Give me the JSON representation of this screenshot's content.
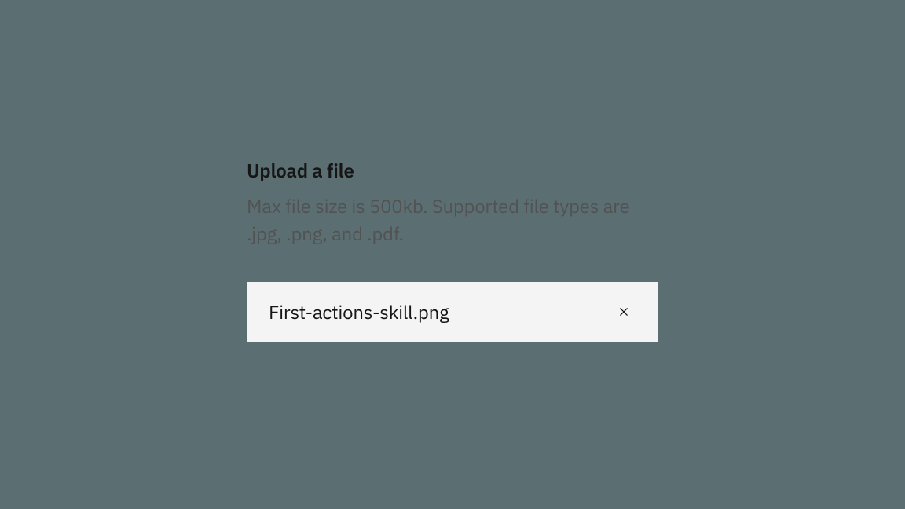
{
  "upload": {
    "title": "Upload a file",
    "description": "Max file size is 500kb. Supported file types are .jpg, .png, and .pdf.",
    "file": {
      "name": "First-actions-skill.png"
    }
  }
}
